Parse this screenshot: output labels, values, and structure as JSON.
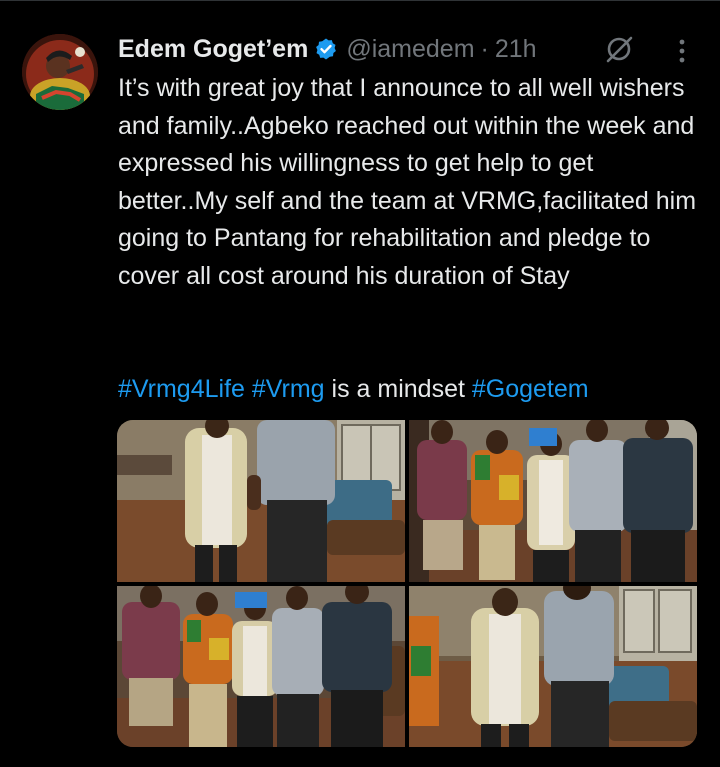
{
  "tweet": {
    "author": {
      "display_name": "Edem Goget’em",
      "handle": "@iamedem",
      "separator": "·",
      "time": "21h",
      "verified_icon": "verified-badge-icon",
      "avatar": "avatar"
    },
    "text": "It’s with great joy that I announce to all well wishers and family..Agbeko reached out within the week and expressed his willingness to get help to get better..My self and the team at VRMG,facilitated him going to Pantang for rehabilitation and pledge to cover all cost around his duration of Stay",
    "hashtag_line": {
      "tag1": "#Vrmg4Life",
      "tag2": "#Vrmg",
      "middle_text": " is a mindset ",
      "tag3": "#Gogetem"
    },
    "actions": {
      "grok_icon": "grok-icon",
      "more_icon": "more-options-icon"
    },
    "media": [
      "photo-1",
      "photo-2",
      "photo-3",
      "photo-4"
    ],
    "colors": {
      "background": "#000000",
      "text": "#e7e9ea",
      "muted": "#71767b",
      "link": "#1d9bf0",
      "verified": "#1d9bf0"
    }
  }
}
